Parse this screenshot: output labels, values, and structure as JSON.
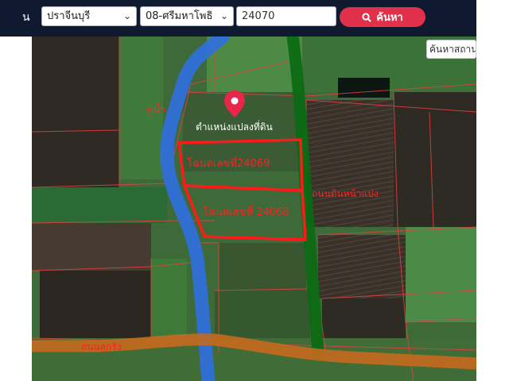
{
  "header": {
    "left_label": "น",
    "province": "ปราจีนบุรี",
    "district": "08-ศรีมหาโพธิ",
    "deed_number": "24070",
    "search_button": "ค้นหา"
  },
  "map": {
    "place_search_placeholder": "ค้นหาสถาน",
    "marker_label": "ตำแหน่งแปลงที่ดิน",
    "canal_label": "คูน้ำ",
    "plot_1_label": "โฉนดเลขที่24069",
    "plot_2_label": "โฉนดเลขที่ 24068",
    "dirt_road_label": "ถนนดินหน้าแปง",
    "main_road_label": "ถนนลูกรัง",
    "colors": {
      "canal": "#2f6fe0",
      "dirt_road": "#0a6a12",
      "main_road": "#c46a1e",
      "plot_outline": "#ff1a1a",
      "marker": "#e8254a"
    }
  }
}
